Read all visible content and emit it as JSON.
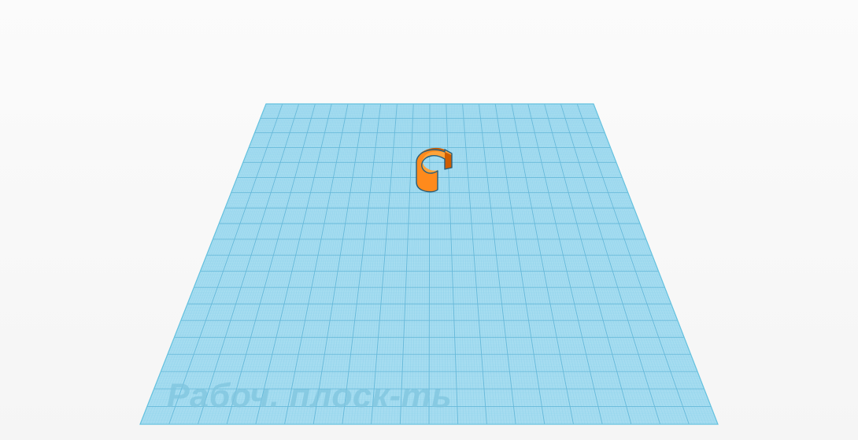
{
  "workplane": {
    "label": "Рабоч. плоск-ть",
    "fill_color": "#a9def1",
    "minor_grid_color": "#8bd0ea",
    "major_grid_color": "#64b8d9",
    "edge_color": "#66c2df"
  },
  "object": {
    "shape": "c-shaped-ring",
    "front_color": "#ff8a1c",
    "side_color": "#cf5d00",
    "top_color": "#ffa43b",
    "outline_color": "#275f7c"
  }
}
